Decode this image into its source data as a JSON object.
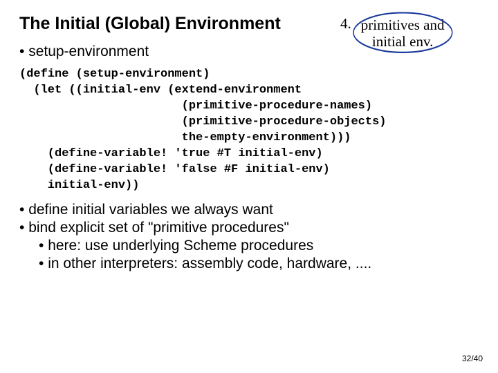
{
  "title": "The Initial (Global) Environment",
  "step": {
    "number": "4.",
    "callout_line1": "primitives and",
    "callout_line2": "initial env."
  },
  "sub_bullet": "setup-environment",
  "code": "(define (setup-environment)\n  (let ((initial-env (extend-environment\n                       (primitive-procedure-names)\n                       (primitive-procedure-objects)\n                       the-empty-environment)))\n    (define-variable! 'true #T initial-env)\n    (define-variable! 'false #F initial-env)\n    initial-env))",
  "notes": {
    "n1": "define initial variables we always want",
    "n2": "bind explicit set of \"primitive procedures\"",
    "n2a": "here: use underlying Scheme procedures",
    "n2b": "in other interpreters: assembly code, hardware, ...."
  },
  "page_number": "32/40"
}
